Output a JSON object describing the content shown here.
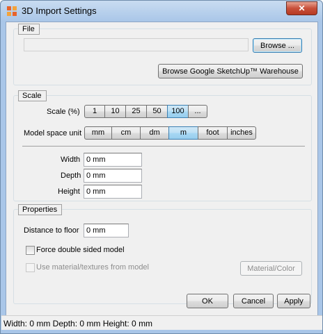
{
  "window": {
    "title": "3D Import Settings",
    "close_label": "✕",
    "accent": "#a9c6e8"
  },
  "file": {
    "legend": "File",
    "path_value": "",
    "browse_label": "Browse ...",
    "warehouse_label": "Browse Google SketchUp™ Warehouse"
  },
  "scale": {
    "legend": "Scale",
    "scale_label": "Scale (%)",
    "scale_options": [
      "1",
      "10",
      "25",
      "50",
      "100",
      "..."
    ],
    "scale_selected": "100",
    "unit_label": "Model space unit",
    "unit_options": [
      "mm",
      "cm",
      "dm",
      "m",
      "foot",
      "inches"
    ],
    "unit_selected": "m",
    "width_label": "Width",
    "width_value": "0 mm",
    "depth_label": "Depth",
    "depth_value": "0 mm",
    "height_label": "Height",
    "height_value": "0 mm"
  },
  "properties": {
    "legend": "Properties",
    "floor_label": "Distance to floor",
    "floor_value": "0 mm",
    "double_sided_label": "Force double sided model",
    "double_sided_checked": false,
    "use_material_label": "Use material/textures from model",
    "use_material_checked": false,
    "material_button_label": "Material/Color"
  },
  "actions": {
    "ok_label": "OK",
    "cancel_label": "Cancel",
    "apply_label": "Apply"
  },
  "status": {
    "text": "Width: 0 mm  Depth: 0 mm  Height: 0 mm"
  }
}
